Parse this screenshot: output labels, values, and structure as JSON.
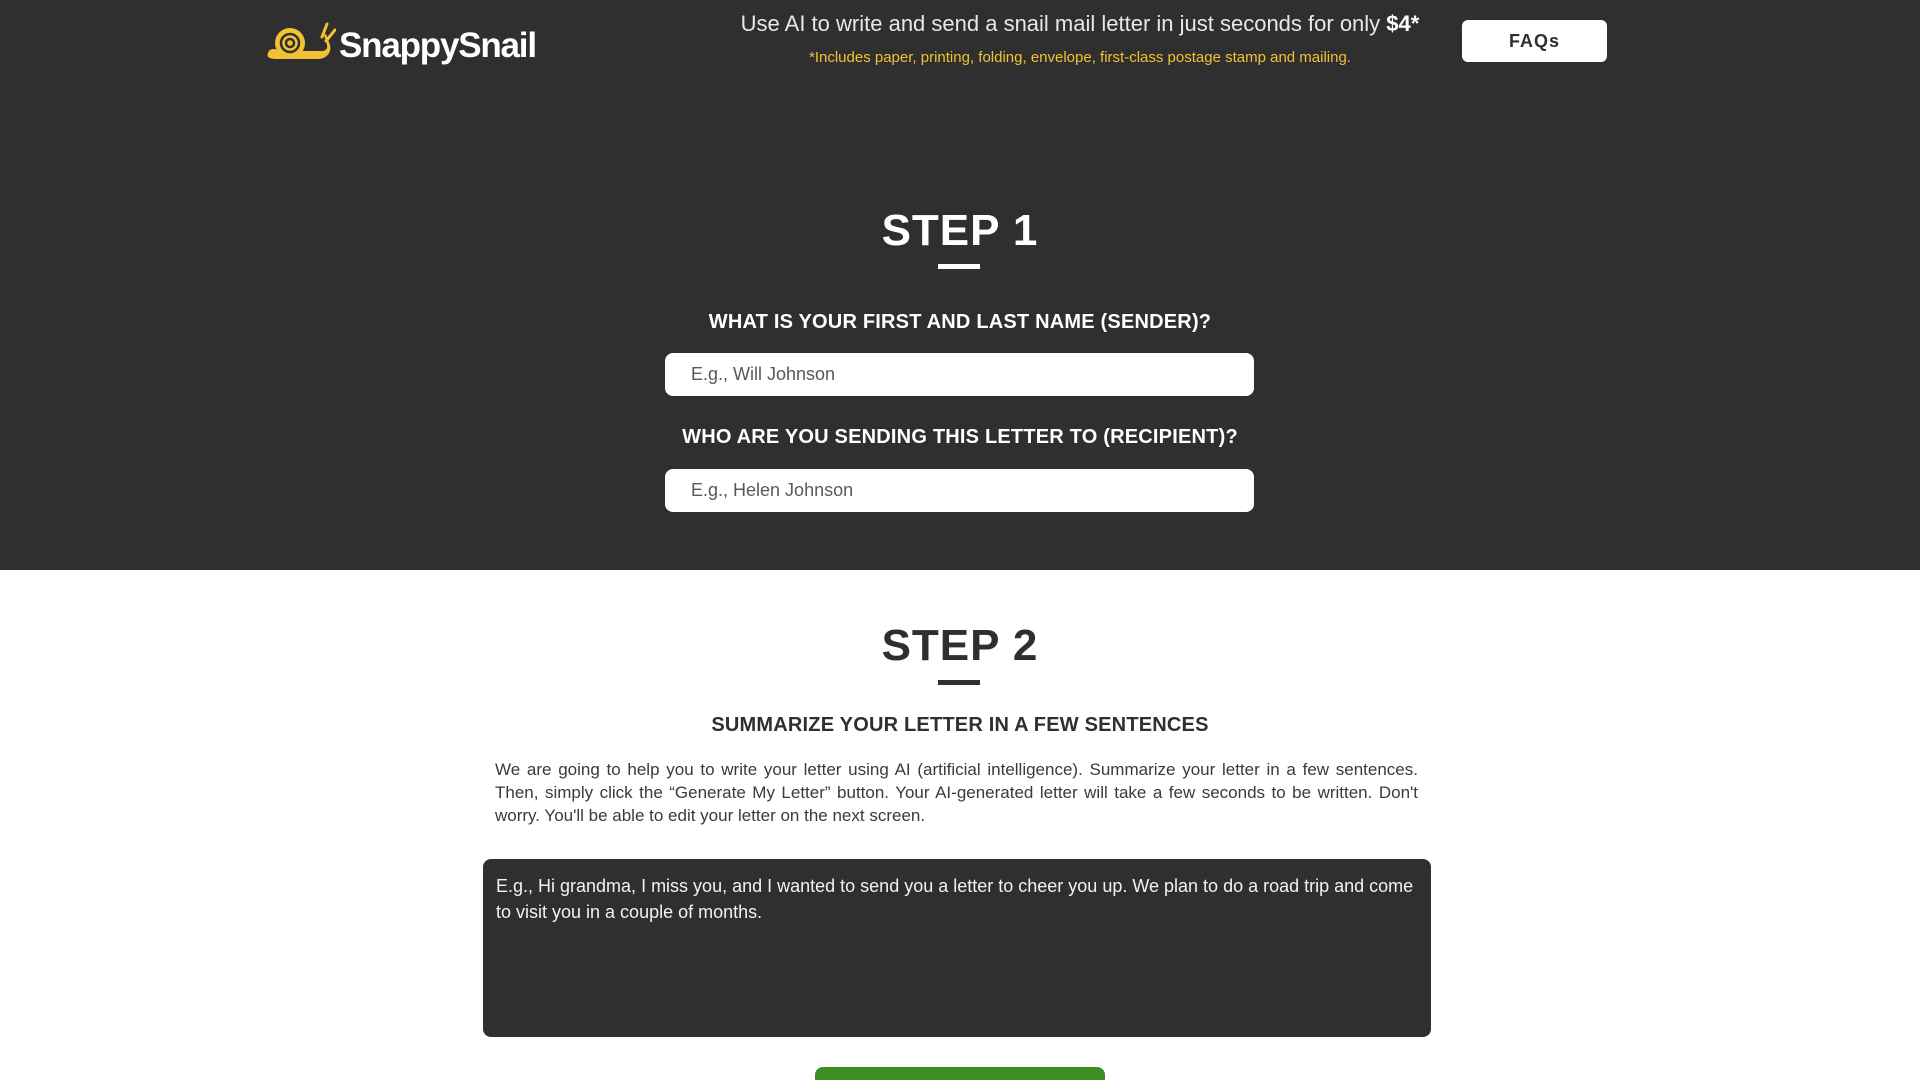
{
  "header": {
    "brand": "SnappySnail",
    "logo_icon": "snail-icon",
    "headline_prefix": "Use AI to write and send a snail mail letter in just seconds for only ",
    "headline_price": "$4*",
    "subline": "*Includes paper, printing, folding, envelope, first-class postage stamp and mailing.",
    "faq_label": "FAQs"
  },
  "step1": {
    "title": "STEP 1",
    "sender_label": "WHAT IS YOUR FIRST AND LAST NAME (SENDER)?",
    "sender_placeholder": "E.g., Will Johnson",
    "recipient_label": "WHO ARE YOU SENDING THIS LETTER TO (RECIPIENT)?",
    "recipient_placeholder": "E.g., Helen Johnson"
  },
  "step2": {
    "title": "STEP 2",
    "heading": "SUMMARIZE YOUR LETTER IN A FEW SENTENCES",
    "description": "We are going to help you to write your letter using AI (artificial intelligence). Summarize your letter in a few sentences. Then, simply click the “Generate My Letter” button. Your AI-generated letter will take a few seconds to be written. Don't worry. You'll be able to edit your letter on the next screen.",
    "summary_placeholder": "E.g., Hi grandma, I miss you, and I wanted to send you a letter to cheer you up. We plan to do a road trip and come to visit you in a couple of months."
  },
  "colors": {
    "dark_bg": "#2f2f2f",
    "accent_yellow": "#f1c232",
    "button_green": "#3c8d22",
    "white": "#ffffff"
  }
}
